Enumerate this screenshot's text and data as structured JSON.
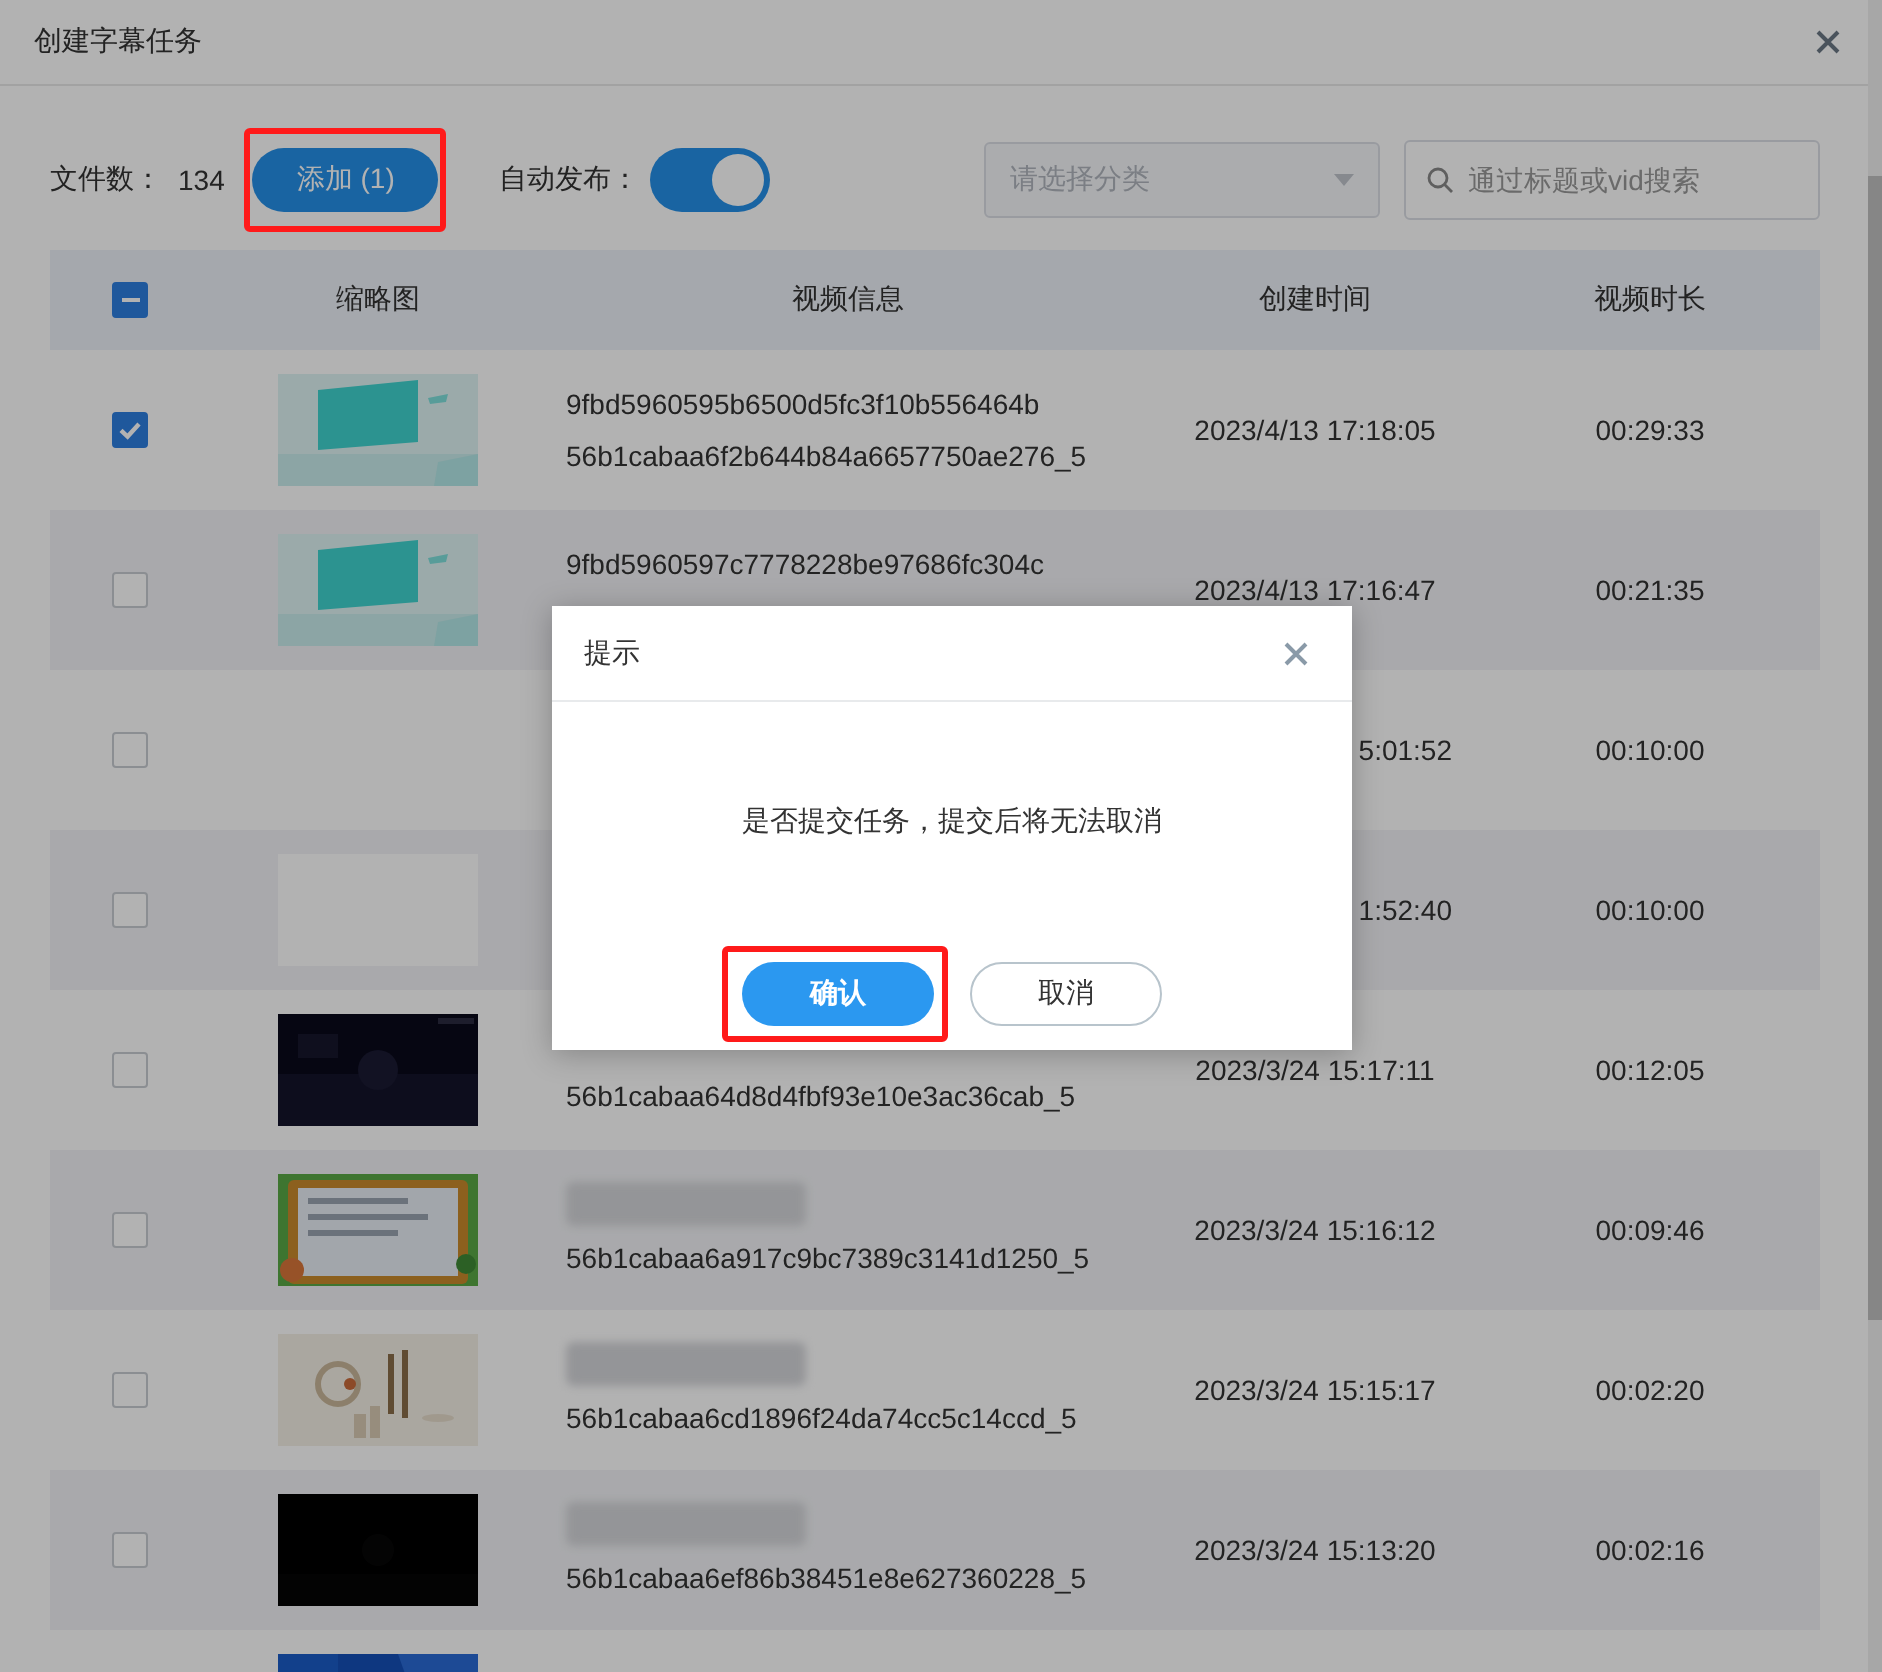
{
  "window": {
    "title": "创建字幕任务"
  },
  "toolbar": {
    "file_count_label": "文件数：",
    "file_count": "134",
    "add_button": {
      "label": "添加 (1)",
      "highlighted": true
    },
    "auto_publish_label": "自动发布：",
    "auto_publish_on": true,
    "category_placeholder": "请选择分类",
    "search_placeholder": "通过标题或vid搜索"
  },
  "table": {
    "header_checkbox": {
      "indeterminate": true
    },
    "columns": [
      "缩略图",
      "视频信息",
      "创建时间",
      "视频时长"
    ],
    "rows": [
      {
        "checked": true,
        "kind": "full",
        "info_top": "9fbd5960595b6500d5fc3f10b556464b",
        "info_bottom": "56b1cabaa6f2b644b84a6657750ae276_5",
        "created": "2023/4/13 17:18:05",
        "duration": "00:29:33"
      },
      {
        "checked": false,
        "kind": "full",
        "info_top": "9fbd5960597c7778228be97686fc304c",
        "created": "2023/4/13 17:16:47",
        "duration": "00:21:35"
      },
      {
        "checked": false,
        "kind": "covered",
        "created": "5:01:52",
        "duration": "00:10:00"
      },
      {
        "checked": false,
        "kind": "covered",
        "thumbnail": {
          "kind": "blank"
        },
        "created": "1:52:40",
        "duration": "00:10:00"
      },
      {
        "checked": false,
        "kind": "full",
        "info_bottom": "56b1cabaa64d8d4fbf93e10e3ac36cab_5",
        "created": "2023/3/24 15:17:11",
        "duration": "00:12:05"
      },
      {
        "checked": false,
        "kind": "full",
        "blurred": true,
        "info_bottom": "56b1cabaa6a917c9bc7389c3141d1250_5",
        "created": "2023/3/24 15:16:12",
        "duration": "00:09:46"
      },
      {
        "checked": false,
        "kind": "full",
        "blurred": true,
        "info_bottom": "56b1cabaa6cd1896f24da74cc5c14ccd_5",
        "created": "2023/3/24 15:15:17",
        "duration": "00:02:20"
      },
      {
        "checked": false,
        "kind": "full",
        "blurred": true,
        "info_bottom": "56b1cabaa6ef86b38451e8e627360228_5",
        "created": "2023/3/24 15:13:20",
        "duration": "00:02:16"
      },
      {
        "kind": "full"
      }
    ]
  },
  "dialog": {
    "title": "提示",
    "message": "是否提交任务，提交后将无法取消",
    "buttons": [
      {
        "label": "确认",
        "kind": "primary",
        "highlighted": true
      },
      {
        "label": "取消",
        "kind": "default",
        "highlighted": false
      }
    ]
  }
}
